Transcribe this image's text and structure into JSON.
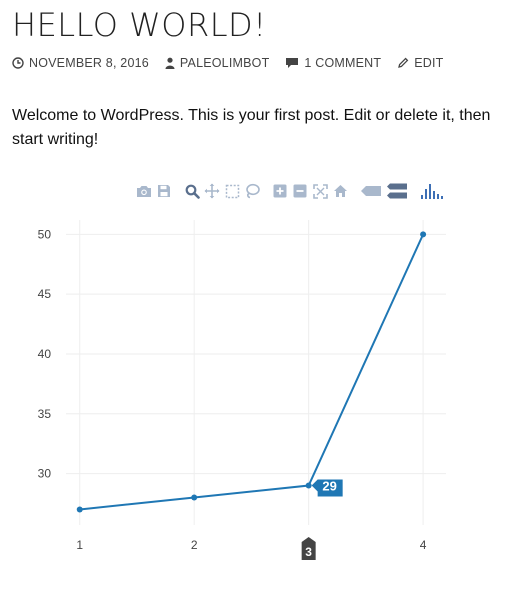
{
  "post": {
    "title": "HELLO WORLD!",
    "meta": {
      "date": "NOVEMBER 8, 2016",
      "author": "PALEOLIMBOT",
      "comments": "1 COMMENT",
      "edit": "EDIT"
    },
    "body": "Welcome to WordPress. This is your first post. Edit or delete it, then start writing!"
  },
  "modebar": {
    "buttons": [
      {
        "icon": "camera-icon",
        "label": "Download plot as png"
      },
      {
        "icon": "save-icon",
        "label": "Save and edit plot in cloud"
      },
      {
        "icon": "zoom-icon",
        "label": "Zoom"
      },
      {
        "icon": "pan-icon",
        "label": "Pan"
      },
      {
        "icon": "box-select-icon",
        "label": "Box Select"
      },
      {
        "icon": "lasso-select-icon",
        "label": "Lasso Select"
      },
      {
        "icon": "zoom-in-icon",
        "label": "Zoom in"
      },
      {
        "icon": "zoom-out-icon",
        "label": "Zoom out"
      },
      {
        "icon": "autoscale-icon",
        "label": "Autoscale"
      },
      {
        "icon": "reset-axes-icon",
        "label": "Reset axes"
      },
      {
        "icon": "hover-closest-icon",
        "label": "Show closest data on hover"
      },
      {
        "icon": "hover-compare-icon",
        "label": "Compare data on hover"
      },
      {
        "icon": "plotly-logo-icon",
        "label": "Produced with Plotly"
      }
    ],
    "colors": {
      "icon": "#a9b8cc",
      "active": "#3d6fb5"
    }
  },
  "chart_data": {
    "type": "line",
    "x": [
      1,
      2,
      3,
      4
    ],
    "series": [
      {
        "values": [
          27,
          28,
          29,
          50
        ],
        "color": "#1f77b4"
      }
    ],
    "xticks": [
      "1",
      "2",
      "3",
      "4"
    ],
    "yticks": [
      "30",
      "35",
      "40",
      "45",
      "50"
    ],
    "xlim": [
      0.88,
      4.2
    ],
    "ylim": [
      25.7,
      51.2
    ],
    "grid": true,
    "hover": {
      "x": "3",
      "y": "29"
    }
  }
}
